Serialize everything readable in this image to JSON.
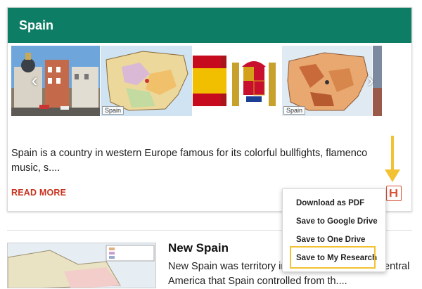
{
  "card": {
    "title": "Spain",
    "description": "Spain is a country in western Europe famous for its colorful bullfights, flamenco music, s....",
    "read_more": "READ MORE",
    "slides": [
      {
        "name": "madrid-street-photo",
        "label": ""
      },
      {
        "name": "spain-map",
        "label": "Spain"
      },
      {
        "name": "spain-flag",
        "label": ""
      },
      {
        "name": "spain-relief-map",
        "label": "Spain"
      },
      {
        "name": "partial-photo",
        "label": ""
      }
    ],
    "icons": {
      "prev": "chevron-left-icon",
      "next": "chevron-right-icon",
      "save": "save-icon"
    }
  },
  "menu": {
    "items": [
      "Download as PDF",
      "Save to Google Drive",
      "Save to One Drive",
      "Save to My Research"
    ],
    "highlighted": "Save to My Research"
  },
  "next_item": {
    "title": "New Spain",
    "description": "New Spain was territory in North America and Central America that Spain controlled from th...."
  },
  "colors": {
    "header": "#0e7d66",
    "accent": "#c8321e",
    "highlight": "#f2c233"
  }
}
